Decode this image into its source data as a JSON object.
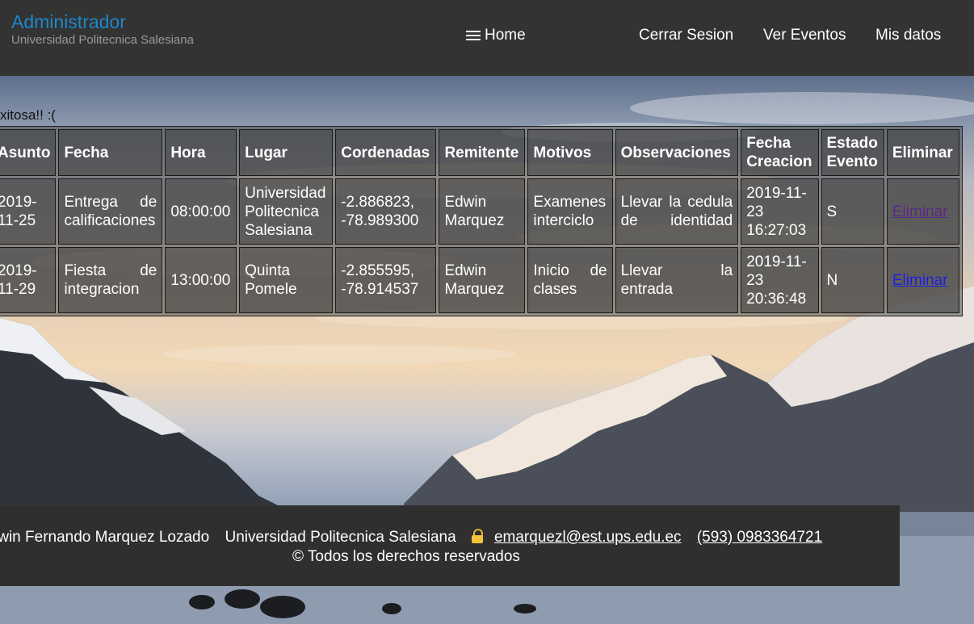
{
  "header": {
    "title": "Administrador",
    "subtitle": "Universidad Politecnica Salesiana",
    "home_label": "Home",
    "nav": [
      "Cerrar Sesion",
      "Ver Eventos",
      "Mis datos"
    ]
  },
  "message": "xitosa!! :(",
  "table": {
    "headers": [
      "Asunto",
      "Fecha",
      "Hora",
      "Lugar",
      "Cordenadas",
      "Remitente",
      "Motivos",
      "Observaciones",
      "Fecha Creacion",
      "Estado Evento",
      "Eliminar"
    ],
    "rows": [
      {
        "asunto": "2019-11-25",
        "fecha": "Entrega de calificaciones",
        "hora": "08:00:00",
        "lugar": "Universidad Politecnica Salesiana",
        "cordenadas": "-2.886823, -78.989300",
        "remitente": "Edwin Marquez",
        "motivos": "Examenes interciclo",
        "observaciones": "Llevar la cedula de identidad",
        "fecha_creacion": "2019-11-23 16:27:03",
        "estado": "S",
        "eliminar": "Eliminar"
      },
      {
        "asunto": "2019-11-29",
        "fecha": "Fiesta de integracion",
        "hora": "13:00:00",
        "lugar": "Quinta Pomele",
        "cordenadas": "-2.855595, -78.914537",
        "remitente": "Edwin Marquez",
        "motivos": "Inicio de clases",
        "observaciones": "Llevar la entrada",
        "fecha_creacion": "2019-11-23 20:36:48",
        "estado": "N",
        "eliminar": "Eliminar"
      }
    ]
  },
  "footer": {
    "author": "Edwin Fernando Marquez Lozado",
    "university": "Universidad Politecnica Salesiana",
    "email": "emarquezl@est.ups.edu.ec",
    "phone": "(593) 0983364721",
    "copyright": "© Todos los derechos reservados"
  }
}
